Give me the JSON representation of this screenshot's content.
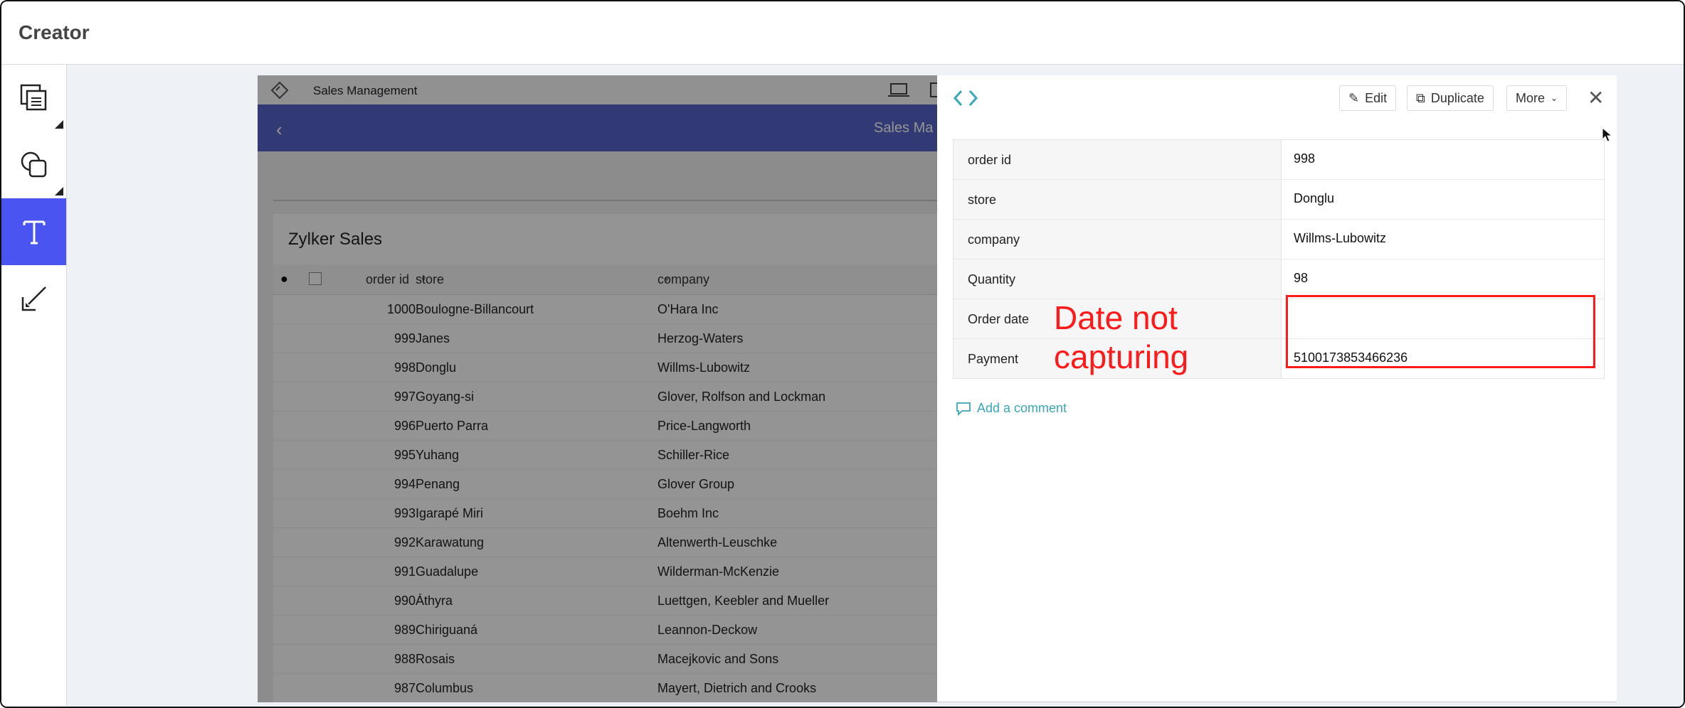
{
  "window": {
    "app_title": "Creator"
  },
  "tools": [
    {
      "name": "copy-tool"
    },
    {
      "name": "shapes-tool"
    },
    {
      "name": "text-tool",
      "active": true
    },
    {
      "name": "pen-tool"
    }
  ],
  "app": {
    "name": "Sales Management",
    "nav_title": "Sales Ma",
    "report_title": "Zylker Sales",
    "columns": {
      "order_id": "order id",
      "store": "store",
      "company": "company"
    },
    "rows": [
      {
        "id": "1000",
        "store": "Boulogne-Billancourt",
        "company": "O'Hara Inc"
      },
      {
        "id": "999",
        "store": "Janes",
        "company": "Herzog-Waters"
      },
      {
        "id": "998",
        "store": "Donglu",
        "company": "Willms-Lubowitz"
      },
      {
        "id": "997",
        "store": "Goyang-si",
        "company": "Glover, Rolfson and Lockman"
      },
      {
        "id": "996",
        "store": "Puerto Parra",
        "company": "Price-Langworth"
      },
      {
        "id": "995",
        "store": "Yuhang",
        "company": "Schiller-Rice"
      },
      {
        "id": "994",
        "store": "Penang",
        "company": "Glover Group"
      },
      {
        "id": "993",
        "store": "Igarapé Miri",
        "company": "Boehm Inc"
      },
      {
        "id": "992",
        "store": "Karawatung",
        "company": "Altenwerth-Leuschke"
      },
      {
        "id": "991",
        "store": "Guadalupe",
        "company": "Wilderman-McKenzie"
      },
      {
        "id": "990",
        "store": "Áthyra",
        "company": "Luettgen, Keebler and Mueller"
      },
      {
        "id": "989",
        "store": "Chiriguaná",
        "company": "Leannon-Deckow"
      },
      {
        "id": "988",
        "store": "Rosais",
        "company": "Macejkovic and Sons"
      },
      {
        "id": "987",
        "store": "Columbus",
        "company": "Mayert, Dietrich and Crooks"
      }
    ]
  },
  "panel": {
    "buttons": {
      "edit": "Edit",
      "duplicate": "Duplicate",
      "more": "More"
    },
    "fields": [
      {
        "label": "order id",
        "value": "998"
      },
      {
        "label": "store",
        "value": "Donglu"
      },
      {
        "label": "company",
        "value": "Willms-Lubowitz"
      },
      {
        "label": "Quantity",
        "value": "98"
      },
      {
        "label": "Order date",
        "value": ""
      },
      {
        "label": "Payment",
        "value": "5100173853466236"
      }
    ],
    "add_comment": "Add a comment"
  },
  "annotation": {
    "line1": "Date not",
    "line2": "capturing",
    "color": "#ff1a1a"
  },
  "colors": {
    "accent": "#4a54f1",
    "app_nav": "#5565c9",
    "link": "#3aa7b9"
  }
}
